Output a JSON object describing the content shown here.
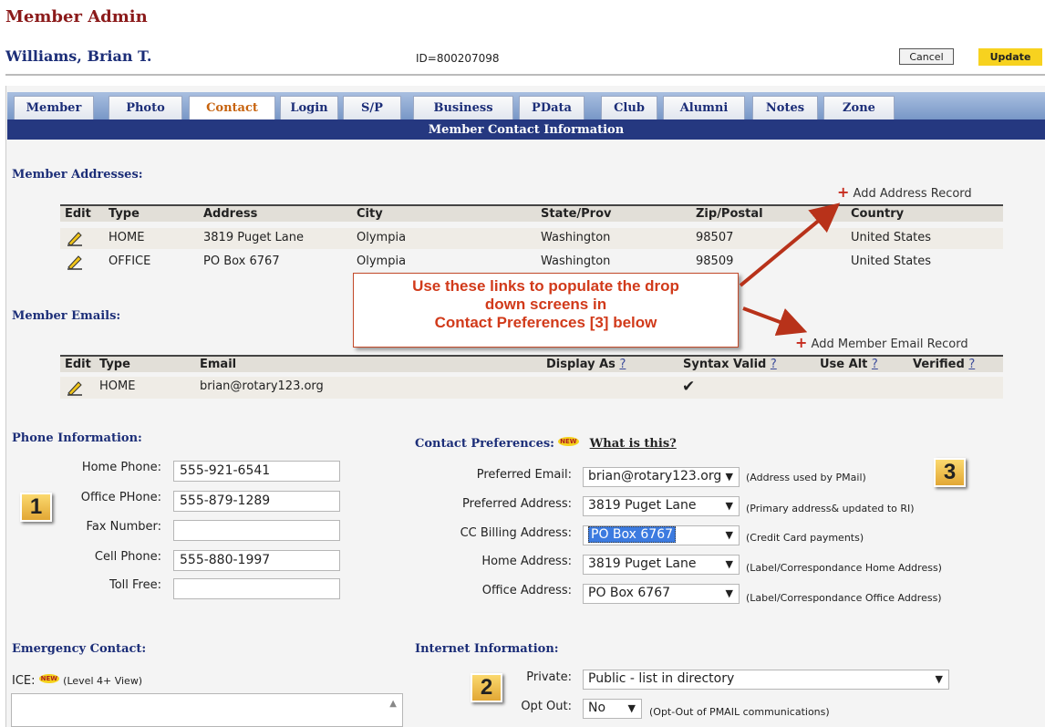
{
  "header": {
    "title": "Member Admin",
    "member_name": "Williams, Brian T.",
    "member_id": "ID=800207098",
    "cancel_label": "Cancel",
    "update_label": "Update"
  },
  "tabs": [
    {
      "label": "Member"
    },
    {
      "label": "Photo"
    },
    {
      "label": "Contact",
      "active": true
    },
    {
      "label": "Login"
    },
    {
      "label": "S/P"
    },
    {
      "label": "Business"
    },
    {
      "label": "PData"
    },
    {
      "label": "Club"
    },
    {
      "label": "Alumni"
    },
    {
      "label": "Notes"
    },
    {
      "label": "Zone"
    }
  ],
  "section_title": "Member Contact Information",
  "addresses": {
    "heading": "Member Addresses:",
    "add_link": "Add Address Record",
    "columns": [
      "Edit",
      "Type",
      "Address",
      "City",
      "State/Prov",
      "Zip/Postal",
      "Country"
    ],
    "rows": [
      {
        "type": "HOME",
        "address": "3819 Puget Lane",
        "city": "Olympia",
        "state": "Washington",
        "zip": "98507",
        "country": "United States"
      },
      {
        "type": "OFFICE",
        "address": "PO Box 6767",
        "city": "Olympia",
        "state": "Washington",
        "zip": "98509",
        "country": "United States"
      }
    ]
  },
  "callout": {
    "line1": "Use these links to populate the drop",
    "line2": "down screens in",
    "line3": "Contact Preferences [3]  below"
  },
  "emails": {
    "heading": "Member Emails:",
    "add_link": "Add Member Email Record",
    "columns": [
      "Edit",
      "Type",
      "Email",
      "Display As",
      "Syntax Valid",
      "Use Alt",
      "Verified"
    ],
    "help_mark": "?",
    "rows": [
      {
        "type": "HOME",
        "email": "brian@rotary123.org",
        "syntax_valid": "✔"
      }
    ]
  },
  "phone": {
    "heading": "Phone Information:",
    "fields": [
      {
        "label": "Home Phone:",
        "value": "555-921-6541"
      },
      {
        "label": "Office PHone:",
        "value": "555-879-1289"
      },
      {
        "label": "Fax Number:",
        "value": ""
      },
      {
        "label": "Cell Phone:",
        "value": "555-880-1997"
      },
      {
        "label": "Toll Free:",
        "value": ""
      }
    ]
  },
  "badges": {
    "b1": "1",
    "b2": "2",
    "b3": "3"
  },
  "preferences": {
    "heading": "Contact Preferences:",
    "new_badge": "NEW",
    "what_link": "What is this?",
    "fields": [
      {
        "label": "Preferred Email:",
        "value": "brian@rotary123.org",
        "note": "(Address used by PMail)"
      },
      {
        "label": "Preferred Address:",
        "value": "3819 Puget Lane",
        "note": "(Primary address& updated to RI)"
      },
      {
        "label": "CC Billing Address:",
        "value": "PO Box 6767",
        "note": "(Credit Card payments)"
      },
      {
        "label": "Home Address:",
        "value": "3819 Puget Lane",
        "note": "(Label/Correspondance Home Address)"
      },
      {
        "label": "Office Address:",
        "value": "PO Box 6767",
        "note": "(Label/Correspondance Office Address)"
      }
    ]
  },
  "emergency": {
    "heading": "Emergency Contact:",
    "ice_label": "ICE:",
    "new_badge": "NEW",
    "ice_note": "(Level 4+ View)"
  },
  "internet": {
    "heading": "Internet Information:",
    "private_label": "Private:",
    "private_value": "Public - list in directory",
    "optout_label": "Opt Out:",
    "optout_value": "No",
    "optout_note": "(Opt-Out of PMAIL communications)"
  },
  "colors": {
    "accent": "#253880",
    "title": "#8b1a1a",
    "update_button": "#f7d21f",
    "callout_text": "#d13a1a"
  }
}
